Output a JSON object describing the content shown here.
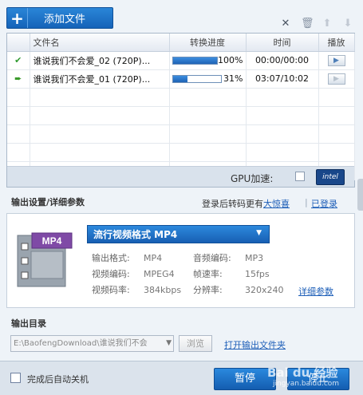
{
  "toolbar": {
    "add_label": "添加文件",
    "icons": [
      "close-icon",
      "trash-icon",
      "arrow-up-icon",
      "arrow-down-icon"
    ]
  },
  "file_table": {
    "headers": [
      "文件名",
      "转换进度",
      "时间",
      "播放"
    ],
    "rows": [
      {
        "status": "✔",
        "name": "谁说我们不会爱_02 (720P)...",
        "progress": 100,
        "progress_label": "100%",
        "time": "00:00/00:00",
        "play_enabled": true
      },
      {
        "status": "➨",
        "name": "谁说我们不会爱_01 (720P)...",
        "progress": 31,
        "progress_label": "31%",
        "time": "03:07/10:02",
        "play_enabled": false
      }
    ]
  },
  "gpu": {
    "label": "GPU加速:",
    "brand": "intel"
  },
  "output_settings": {
    "title": "输出设置/详细参数",
    "login_prompt": "登录后转码更有",
    "surprise_link": "大惊喜",
    "separator": "|",
    "logged_in_link": "已登录",
    "format_badge": "MP4",
    "format_label": "流行视频格式 MP4",
    "params": [
      {
        "k1": "输出格式:",
        "v1": "MP4",
        "k2": "音频编码:",
        "v2": "MP3"
      },
      {
        "k1": "视频编码:",
        "v1": "MPEG4",
        "k2": "帧速率:",
        "v2": "15fps"
      },
      {
        "k1": "视频码率:",
        "v1": "384kbps",
        "k2": "分辨率:",
        "v2": "320x240"
      }
    ],
    "detail_link": "详细参数"
  },
  "output_dir": {
    "title": "输出目录",
    "path": "E:\\BaofengDownload\\谁说我们不会",
    "browse_label": "浏览",
    "open_link": "打开输出文件夹"
  },
  "footer": {
    "auto_shutdown_label": "完成后自动关机",
    "pause_label": "暂停",
    "stop_label": "停止"
  },
  "watermark": {
    "line1": "Bai du 经验",
    "line2": "jingyan.baidu.com"
  },
  "colors": {
    "accent": "#1a6fc9",
    "link": "#1e5fb8",
    "success": "#2f9a2f"
  }
}
